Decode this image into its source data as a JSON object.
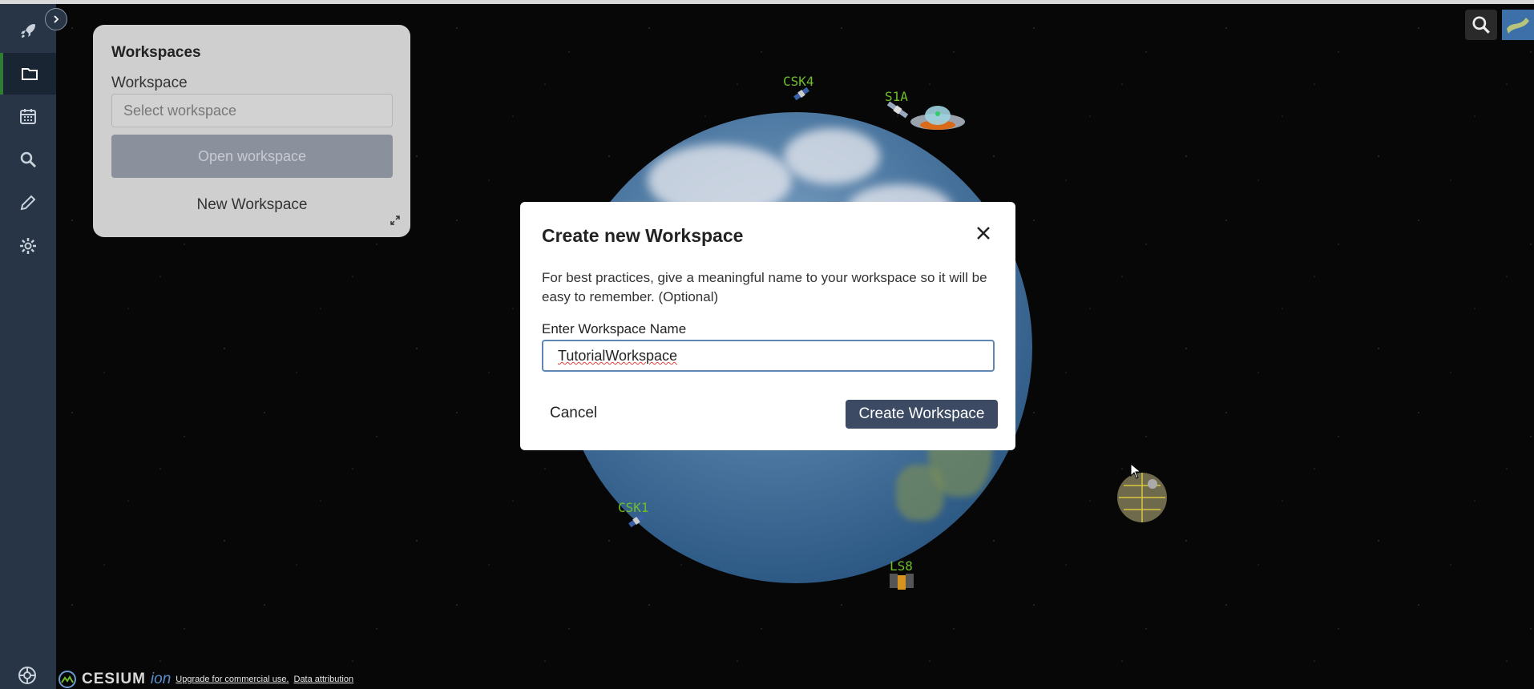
{
  "sidebar": {
    "items": [
      {
        "name": "launch"
      },
      {
        "name": "workspaces"
      },
      {
        "name": "calendar"
      },
      {
        "name": "search"
      },
      {
        "name": "edit"
      },
      {
        "name": "settings"
      }
    ],
    "active": "workspaces"
  },
  "workspaces_panel": {
    "title": "Workspaces",
    "workspace_label": "Workspace",
    "select_placeholder": "Select workspace",
    "open_button": "Open workspace",
    "new_workspace": "New Workspace"
  },
  "dialog": {
    "title": "Create new Workspace",
    "description": "For best practices, give a meaningful name to your workspace so it will be easy to remember. (Optional)",
    "input_label": "Enter Workspace Name",
    "input_value": "TutorialWorkspace",
    "cancel": "Cancel",
    "create": "Create Workspace"
  },
  "satellites": [
    {
      "label": "CSK4"
    },
    {
      "label": "S1A"
    },
    {
      "label": "CSK1"
    },
    {
      "label": "LS8"
    }
  ],
  "footer": {
    "logo": "CESIUM",
    "logo_suffix": "ion",
    "upgrade_link": "Upgrade for commercial use.",
    "attribution_link": "Data attribution"
  },
  "colors": {
    "sidebar_bg": "#283547",
    "active_indicator": "#2e7d32",
    "primary_button": "#3c4a63",
    "satellite_label": "#6fbf2b"
  }
}
